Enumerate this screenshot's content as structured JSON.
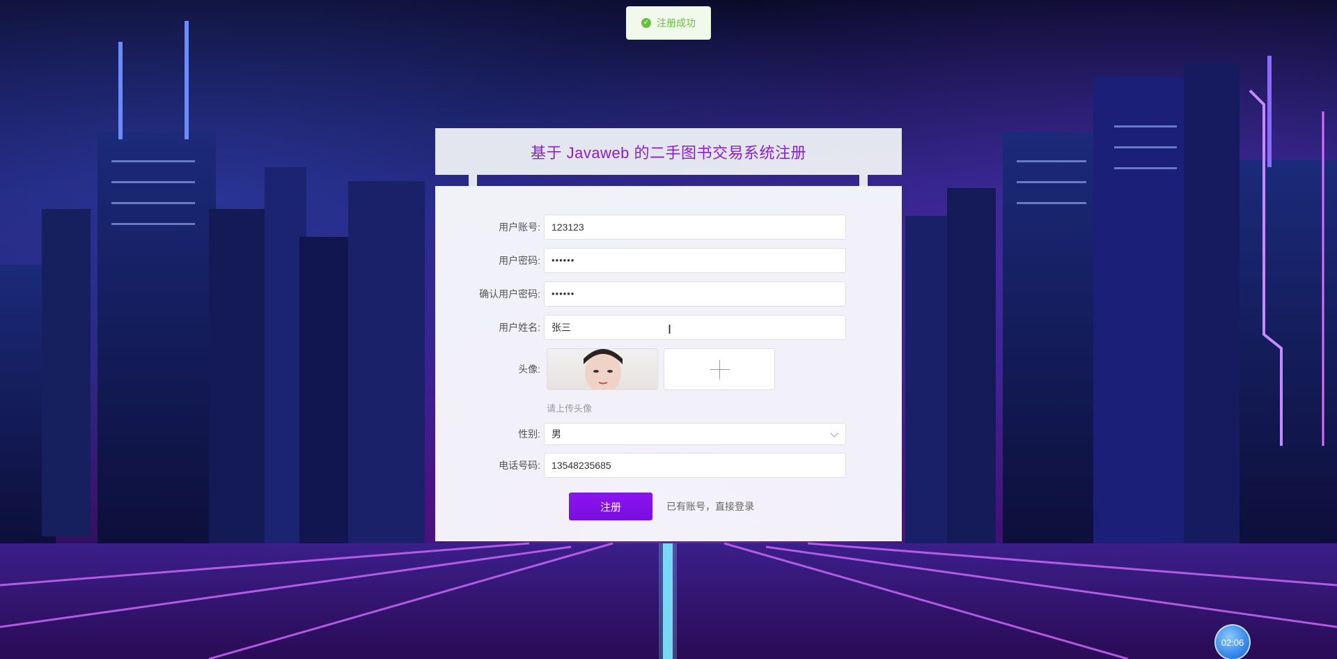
{
  "toast": {
    "message": "注册成功"
  },
  "header": {
    "title": "基于 Javaweb 的二手图书交易系统注册"
  },
  "form": {
    "account": {
      "label": "用户账号:",
      "value": "123123"
    },
    "password": {
      "label": "用户密码:",
      "value": "••••••"
    },
    "confirm_password": {
      "label": "确认用户密码:",
      "value": "••••••"
    },
    "name": {
      "label": "用户姓名:",
      "value": "张三"
    },
    "avatar": {
      "label": "头像:",
      "hint": "请上传头像"
    },
    "gender": {
      "label": "性别:",
      "value": "男"
    },
    "phone": {
      "label": "电话号码:",
      "value": "13548235685"
    },
    "register_button": "注册",
    "login_link": "已有账号，直接登录"
  },
  "clock": {
    "time": "02:06"
  },
  "colors": {
    "accent": "#8a1ed6",
    "button": "#7f0fe6",
    "toast_success": "#67c23a"
  }
}
